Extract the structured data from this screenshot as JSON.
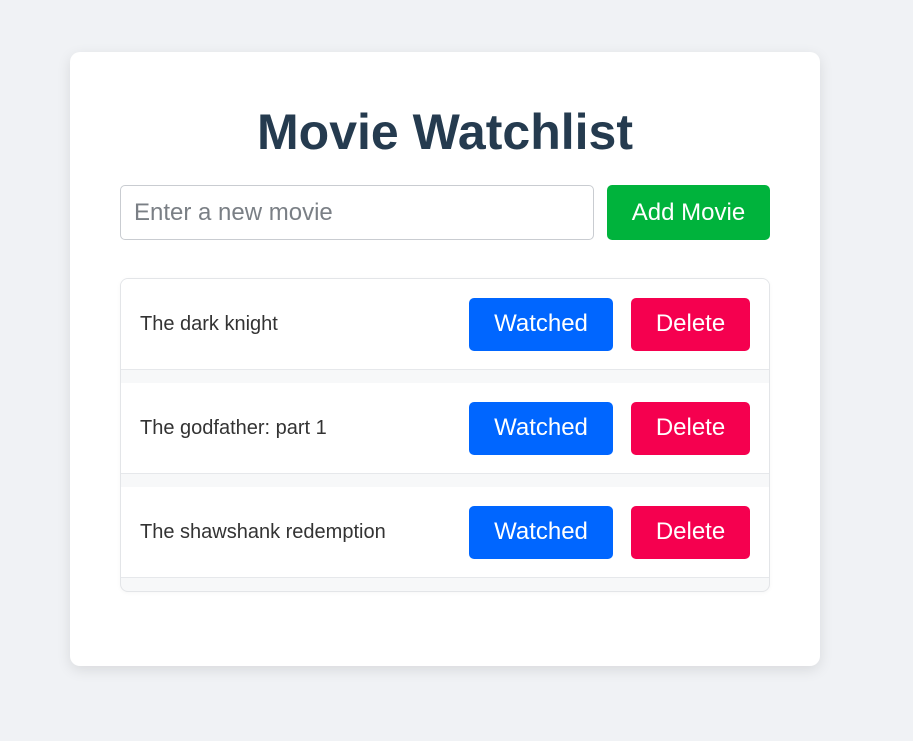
{
  "app": {
    "title": "Movie Watchlist"
  },
  "add_form": {
    "input_value": "",
    "input_placeholder": "Enter a new movie",
    "add_label": "Add Movie"
  },
  "movies": [
    {
      "title": "The dark knight",
      "watched_label": "Watched",
      "delete_label": "Delete"
    },
    {
      "title": "The godfather: part 1",
      "watched_label": "Watched",
      "delete_label": "Delete"
    },
    {
      "title": "The shawshank redemption",
      "watched_label": "Watched",
      "delete_label": "Delete"
    }
  ],
  "colors": {
    "background": "#f0f2f5",
    "title": "#253b4f",
    "add_button": "#00b33c",
    "watched_button": "#0066ff",
    "delete_button": "#f5004f"
  }
}
